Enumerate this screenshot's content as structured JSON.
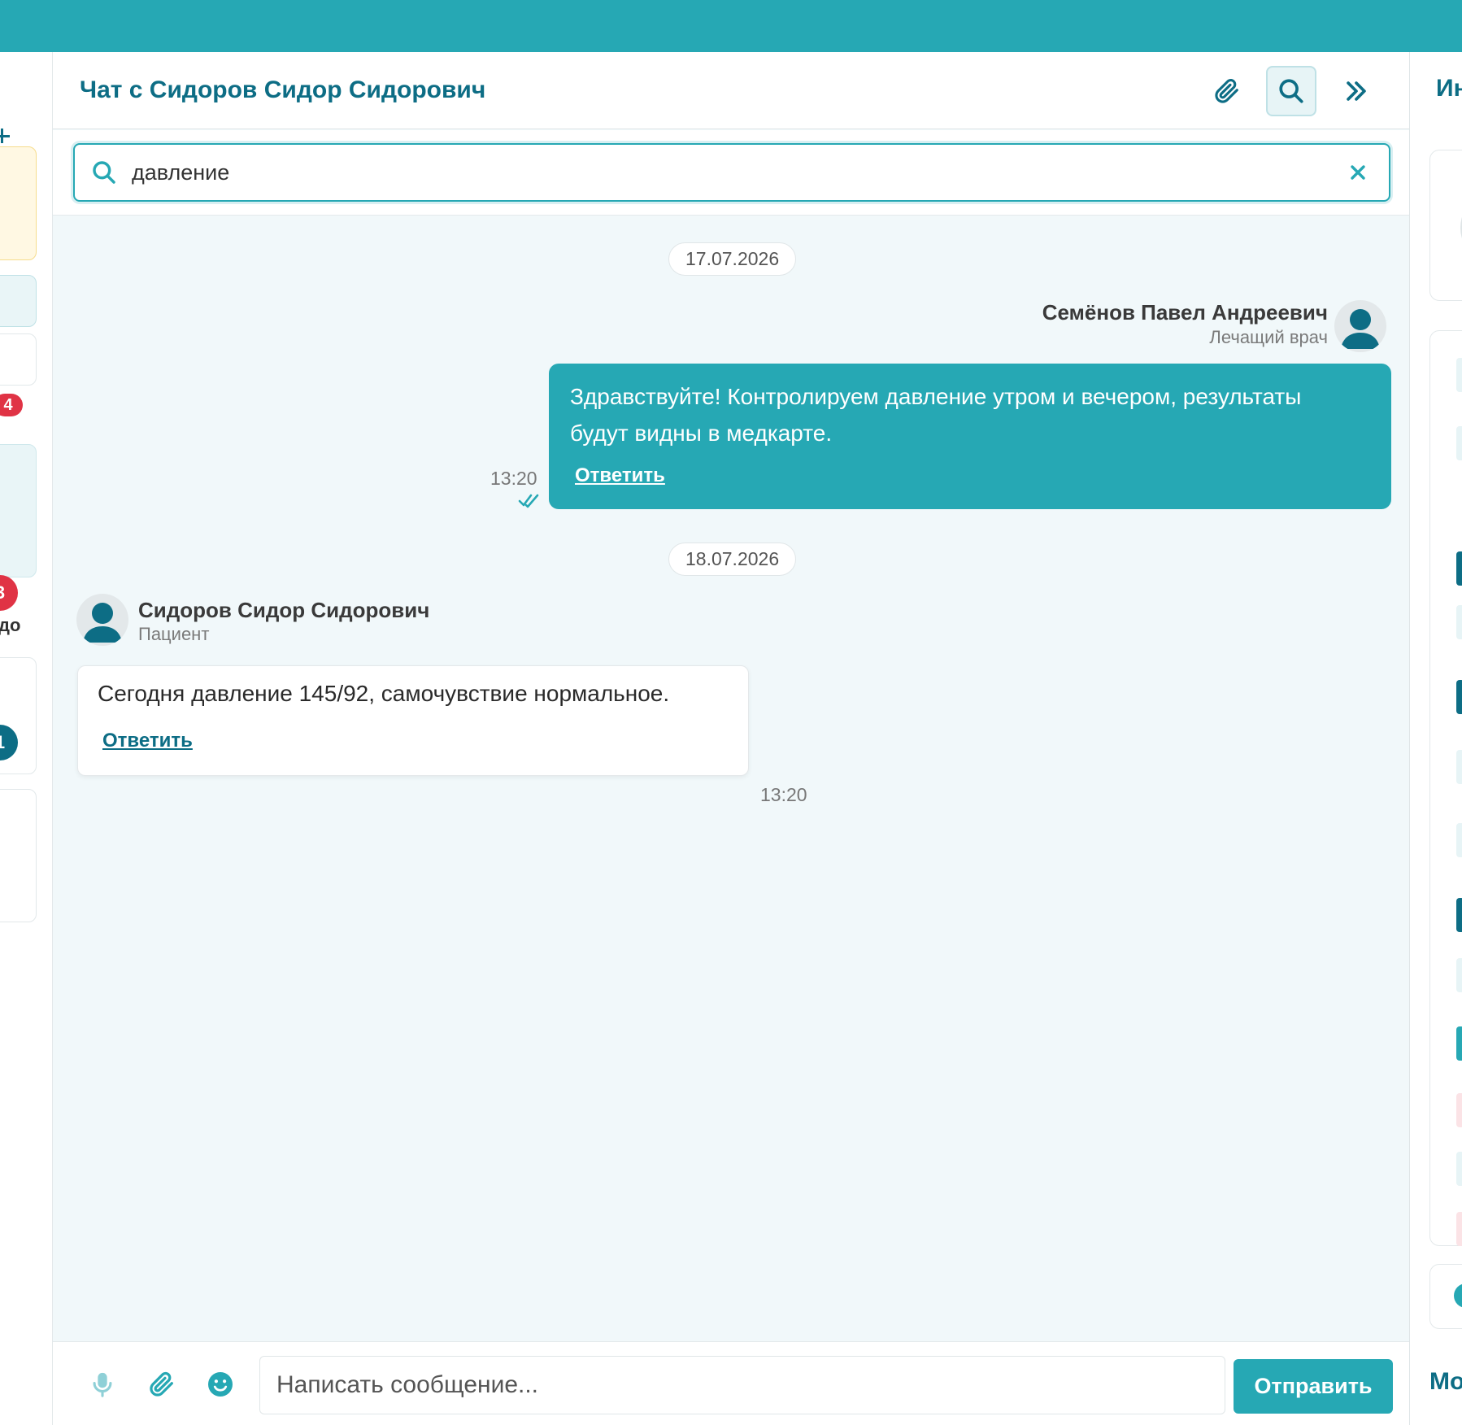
{
  "chat": {
    "title": "Чат с Сидоров Сидор Сидорович",
    "search_value": "давление",
    "messages": [
      {
        "date": "17.07.2026",
        "sender": "Семёнов Павел Андреевич",
        "role": "Лечащий врач",
        "text": "Здравствуйте! Контролируем давление утром и вечером, результаты будут видны в медкарте.",
        "reply_label": "Ответить",
        "time": "13:20"
      },
      {
        "date": "18.07.2026",
        "sender": "Сидоров Сидор Сидорович",
        "role": "Пациент",
        "text": "Сегодня давление 145/92, самочувствие нормальное.",
        "reply_label": "Ответить",
        "time": "13:20"
      }
    ],
    "composer": {
      "placeholder": "Написать сообщение...",
      "send_label": "Отправить"
    }
  },
  "left": {
    "badges": [
      "4",
      "3",
      "1"
    ],
    "partial_text": "до"
  },
  "right": {
    "title": "Ин",
    "bottom_title": "Мо"
  },
  "colors": {
    "accent": "#26a8b4",
    "brand_dark": "#0d6d85",
    "alert_red": "#e03345",
    "chat_bg": "#f1f8fa"
  }
}
